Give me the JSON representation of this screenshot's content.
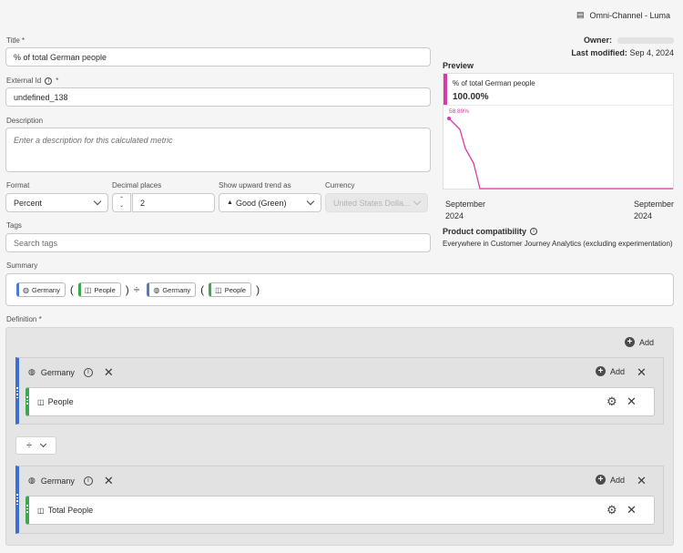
{
  "header": {
    "workspace": "Omni-Channel - Luma"
  },
  "meta": {
    "owner_label": "Owner:",
    "last_modified_label": "Last modified:",
    "last_modified_value": "Sep 4, 2024"
  },
  "form": {
    "title_label": "Title",
    "title_value": "% of total German people",
    "external_id_label": "External Id",
    "external_id_value": "undefined_138",
    "description_label": "Description",
    "description_placeholder": "Enter a description for this calculated metric",
    "format_label": "Format",
    "format_value": "Percent",
    "decimal_label": "Decimal places",
    "decimal_value": "2",
    "trend_label": "Show upward trend as",
    "trend_value": "Good (Green)",
    "currency_label": "Currency",
    "currency_value": "United States Dolla...",
    "tags_label": "Tags",
    "tags_placeholder": "Search tags",
    "summary_label": "Summary",
    "definition_label": "Definition"
  },
  "summary": {
    "chips": [
      "Germany",
      "People",
      "Germany",
      "People"
    ],
    "open_paren": "(",
    "close_paren": ")",
    "operator": "÷"
  },
  "preview": {
    "heading": "Preview",
    "metric_title": "% of total German people",
    "metric_value": "100.00%",
    "point_label": "58.89%",
    "x_start": "September",
    "x_start_year": "2024",
    "x_end": "September",
    "x_end_year": "2024",
    "compat_label": "Product compatibility",
    "compat_value": "Everywhere in Customer Journey Analytics (excluding experimentation)",
    "accent": "#d63ba8"
  },
  "definition": {
    "add_label": "Add",
    "operator": "÷",
    "containers": [
      {
        "segment": "Germany",
        "add_label": "Add",
        "metric": "People"
      },
      {
        "segment": "Germany",
        "add_label": "Add",
        "metric": "Total People"
      }
    ]
  }
}
